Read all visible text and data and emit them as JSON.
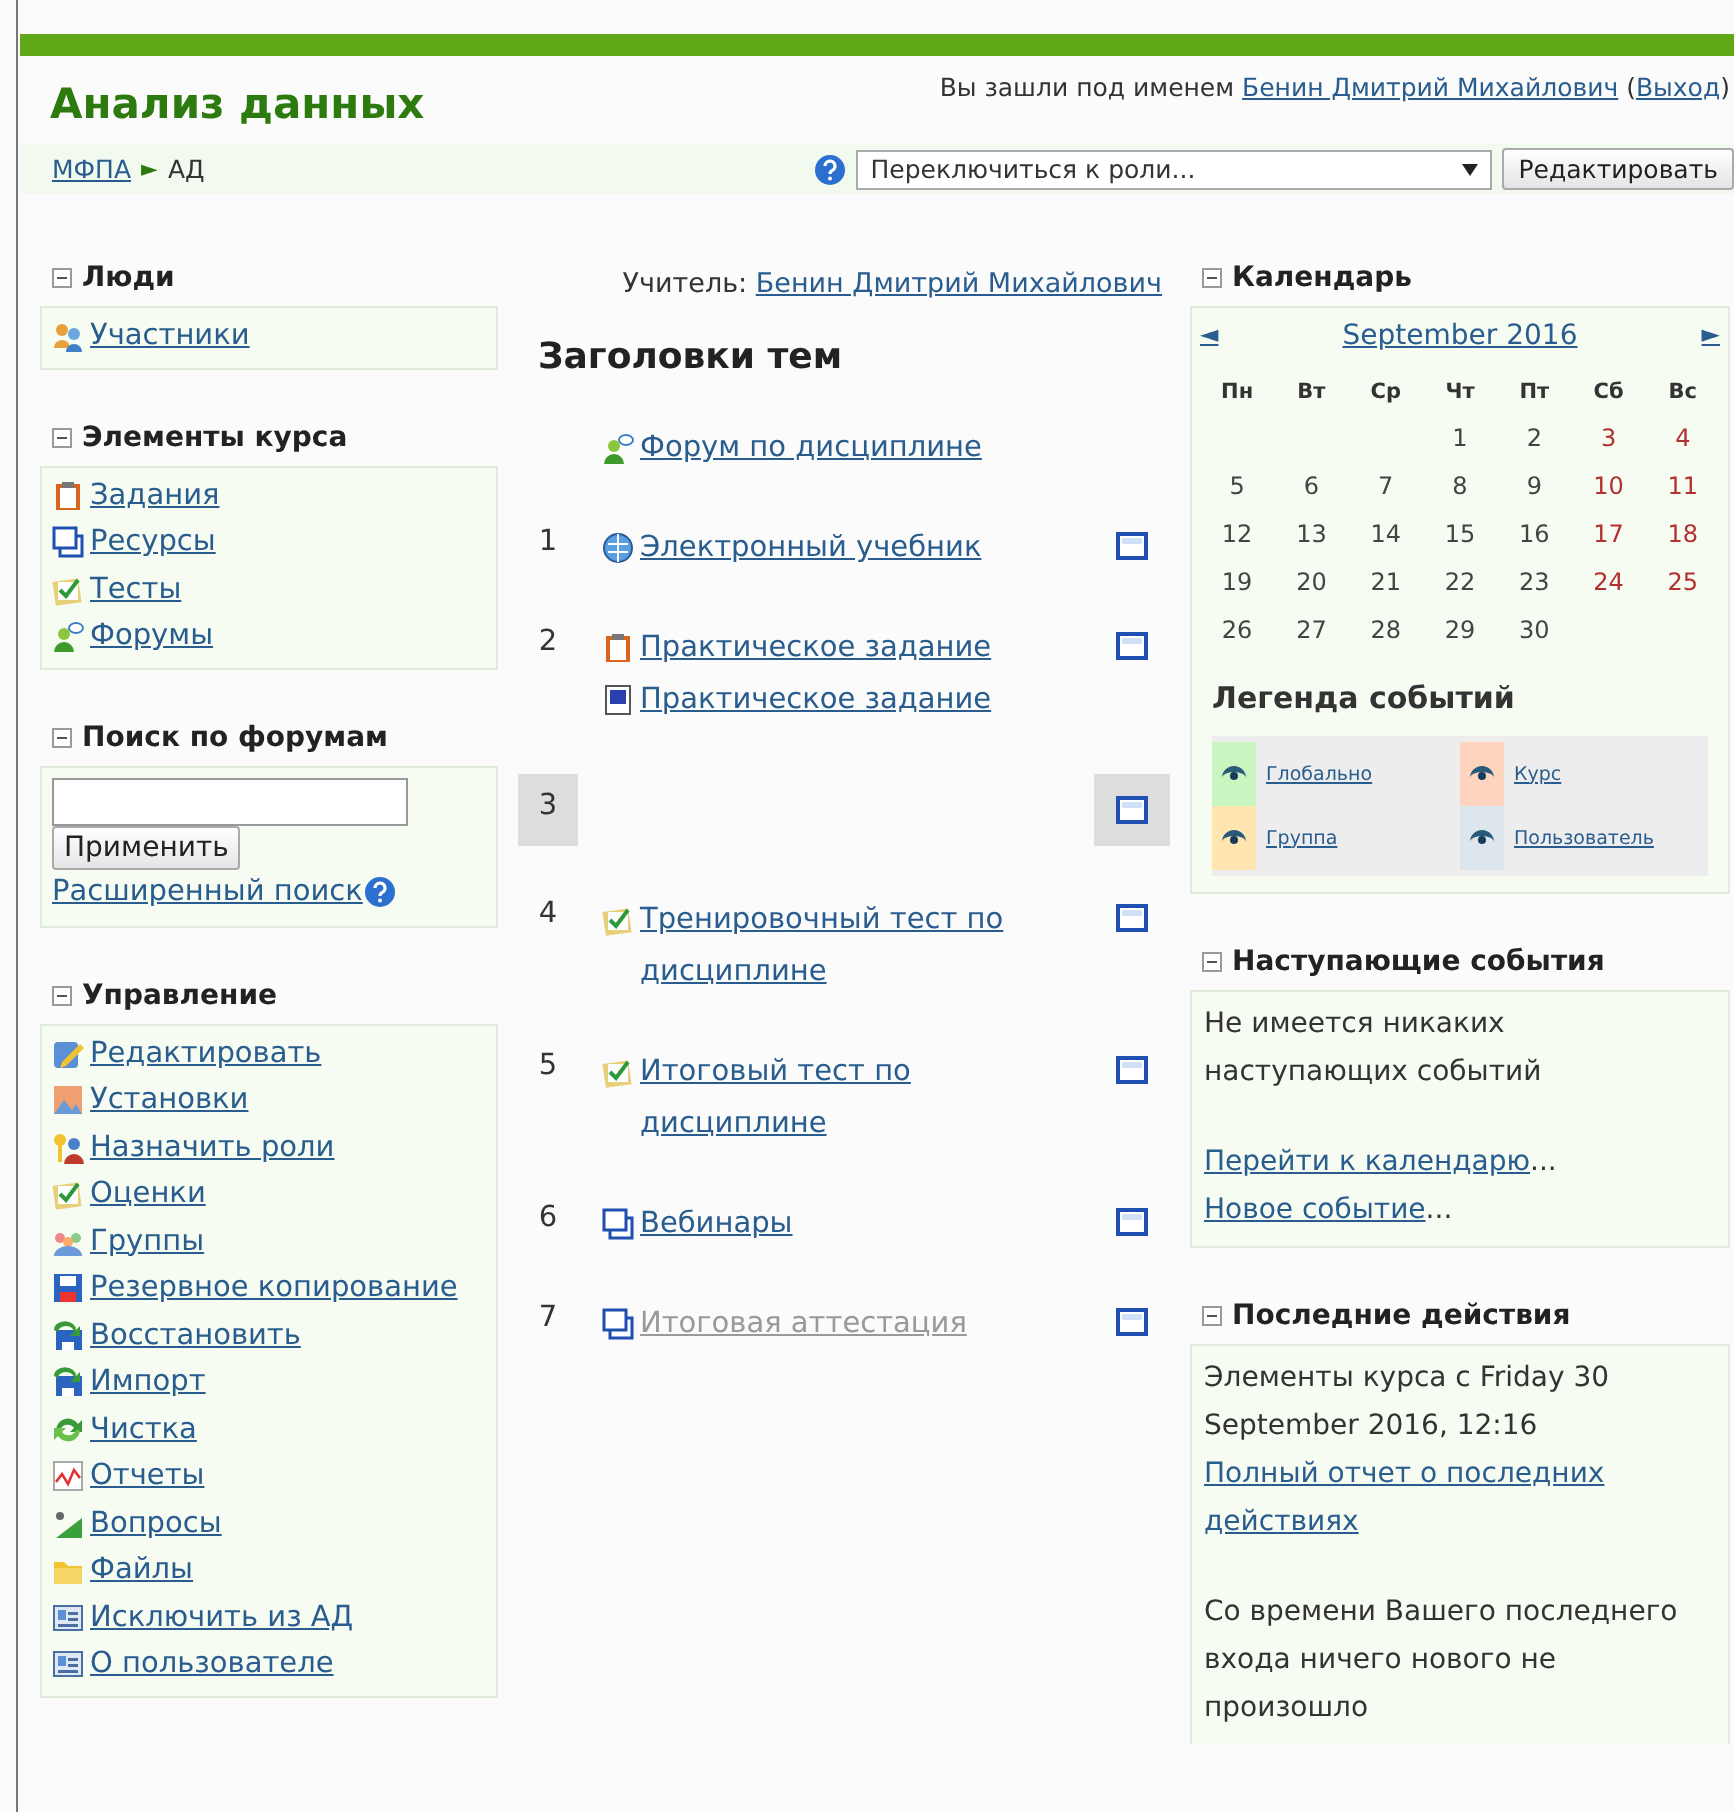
{
  "header": {
    "title": "Анализ данных",
    "login": [
      {
        "text": "Вы зашли под именем ",
        "link": false
      },
      {
        "text": "Бенин Дмитрий Михайлович",
        "link": true
      },
      {
        "text": " (",
        "link": false
      },
      {
        "text": "Выход",
        "link": true
      },
      {
        "text": ")",
        "link": false
      }
    ]
  },
  "navbar": {
    "breadcrumb": [
      {
        "text": "МФПА",
        "link": true
      },
      {
        "text": "►",
        "link": false
      },
      {
        "text": "АД",
        "link": false
      }
    ],
    "role_select": {
      "value": "Переключиться к роли..."
    },
    "edit_button": "Редактировать"
  },
  "left_blocks": [
    {
      "kind": "links",
      "title": "Люди",
      "items": [
        {
          "kind": "users",
          "label": "Участники"
        }
      ]
    },
    {
      "kind": "links",
      "title": "Элементы курса",
      "items": [
        {
          "kind": "assignment",
          "label": "Задания"
        },
        {
          "kind": "resource",
          "label": "Ресурсы"
        },
        {
          "kind": "quiz",
          "label": "Тесты"
        },
        {
          "kind": "forum",
          "label": "Форумы"
        }
      ]
    },
    {
      "kind": "search",
      "title": "Поиск по форумам",
      "button": "Применить",
      "advanced": "Расширенный поиск"
    },
    {
      "kind": "links",
      "title": "Управление",
      "items": [
        {
          "kind": "edit",
          "label": "Редактировать"
        },
        {
          "kind": "settings",
          "label": "Установки"
        },
        {
          "kind": "roles",
          "label": "Назначить роли"
        },
        {
          "kind": "quiz",
          "label": "Оценки"
        },
        {
          "kind": "groups",
          "label": "Группы"
        },
        {
          "kind": "backup",
          "label": "Резервное копирование"
        },
        {
          "kind": "restore",
          "label": "Восстановить"
        },
        {
          "kind": "restore",
          "label": "Импорт"
        },
        {
          "kind": "reset",
          "label": "Чистка"
        },
        {
          "kind": "reports",
          "label": "Отчеты"
        },
        {
          "kind": "questions",
          "label": "Вопросы"
        },
        {
          "kind": "files",
          "label": "Файлы"
        },
        {
          "kind": "profile",
          "label": "Исключить из АД"
        },
        {
          "kind": "profile",
          "label": "О пользователе"
        }
      ]
    }
  ],
  "center": {
    "teacher": [
      {
        "text": "Учитель: ",
        "link": false
      },
      {
        "text": "Бенин Дмитрий Михайлович",
        "link": true
      }
    ],
    "heading": "Заголовки тем",
    "sections": [
      {
        "current": false,
        "activities": [
          {
            "kind": "forum",
            "title": "Форум по дисциплине",
            "hidden": false
          }
        ]
      },
      {
        "number": "1",
        "current": false,
        "activities": [
          {
            "kind": "book",
            "title": "Электронный учебник",
            "hidden": false
          }
        ]
      },
      {
        "number": "2",
        "current": false,
        "activities": [
          {
            "kind": "assignment",
            "title": "Практическое задание",
            "hidden": false
          },
          {
            "kind": "document",
            "title": "Практическое задание",
            "hidden": false
          }
        ]
      },
      {
        "number": "3",
        "current": true
      },
      {
        "number": "4",
        "current": false,
        "activities": [
          {
            "kind": "quiz",
            "title": "Тренировочный тест по дисциплине",
            "hidden": false
          }
        ]
      },
      {
        "number": "5",
        "current": false,
        "activities": [
          {
            "kind": "quiz",
            "title": "Итоговый тест по дисциплине",
            "hidden": false
          }
        ]
      },
      {
        "number": "6",
        "current": false,
        "activities": [
          {
            "kind": "resource",
            "title": "Вебинары",
            "hidden": false
          }
        ]
      },
      {
        "number": "7",
        "current": false,
        "activities": [
          {
            "kind": "resource",
            "title": "Итоговая аттестация",
            "hidden": true
          }
        ]
      }
    ]
  },
  "calendar": {
    "title": "Календарь",
    "prev": "◄",
    "month": "September 2016",
    "next": "►",
    "weekdays": [
      "Пн",
      "Вт",
      "Ср",
      "Чт",
      "Пт",
      "Сб",
      "Вс"
    ],
    "weeks": [
      [
        "1",
        "2",
        "3",
        "4"
      ],
      [
        "5",
        "6",
        "7",
        "8",
        "9",
        "10",
        "11"
      ],
      [
        "12",
        "13",
        "14",
        "15",
        "16",
        "17",
        "18"
      ],
      [
        "19",
        "20",
        "21",
        "22",
        "23",
        "24",
        "25"
      ],
      [
        "26",
        "27",
        "28",
        "29",
        "30"
      ]
    ],
    "legend_title": "Легенда событий",
    "legend": [
      {
        "label": "Глобально",
        "color": "#c8f5c0"
      },
      {
        "label": "Курс",
        "color": "#ffd4bf"
      },
      {
        "label": "Группа",
        "color": "#ffe6b0"
      },
      {
        "label": "Пользователь",
        "color": "#dde6ec"
      }
    ]
  },
  "upcoming": {
    "title": "Наступающие события",
    "text": "Не имеется никаких наступающих событий",
    "links": [
      [
        {
          "text": "Перейти к календарю",
          "link": true
        },
        {
          "text": "...",
          "link": false
        }
      ],
      [
        {
          "text": "Новое событие",
          "link": true
        },
        {
          "text": "...",
          "link": false
        }
      ]
    ]
  },
  "recent": {
    "title": "Последние действия",
    "since": "Элементы курса с Friday 30 September 2016, 12:16",
    "report_link": "Полный отчет о последних действиях",
    "message": "Со времени Вашего последнего входа ничего нового не произошло"
  }
}
